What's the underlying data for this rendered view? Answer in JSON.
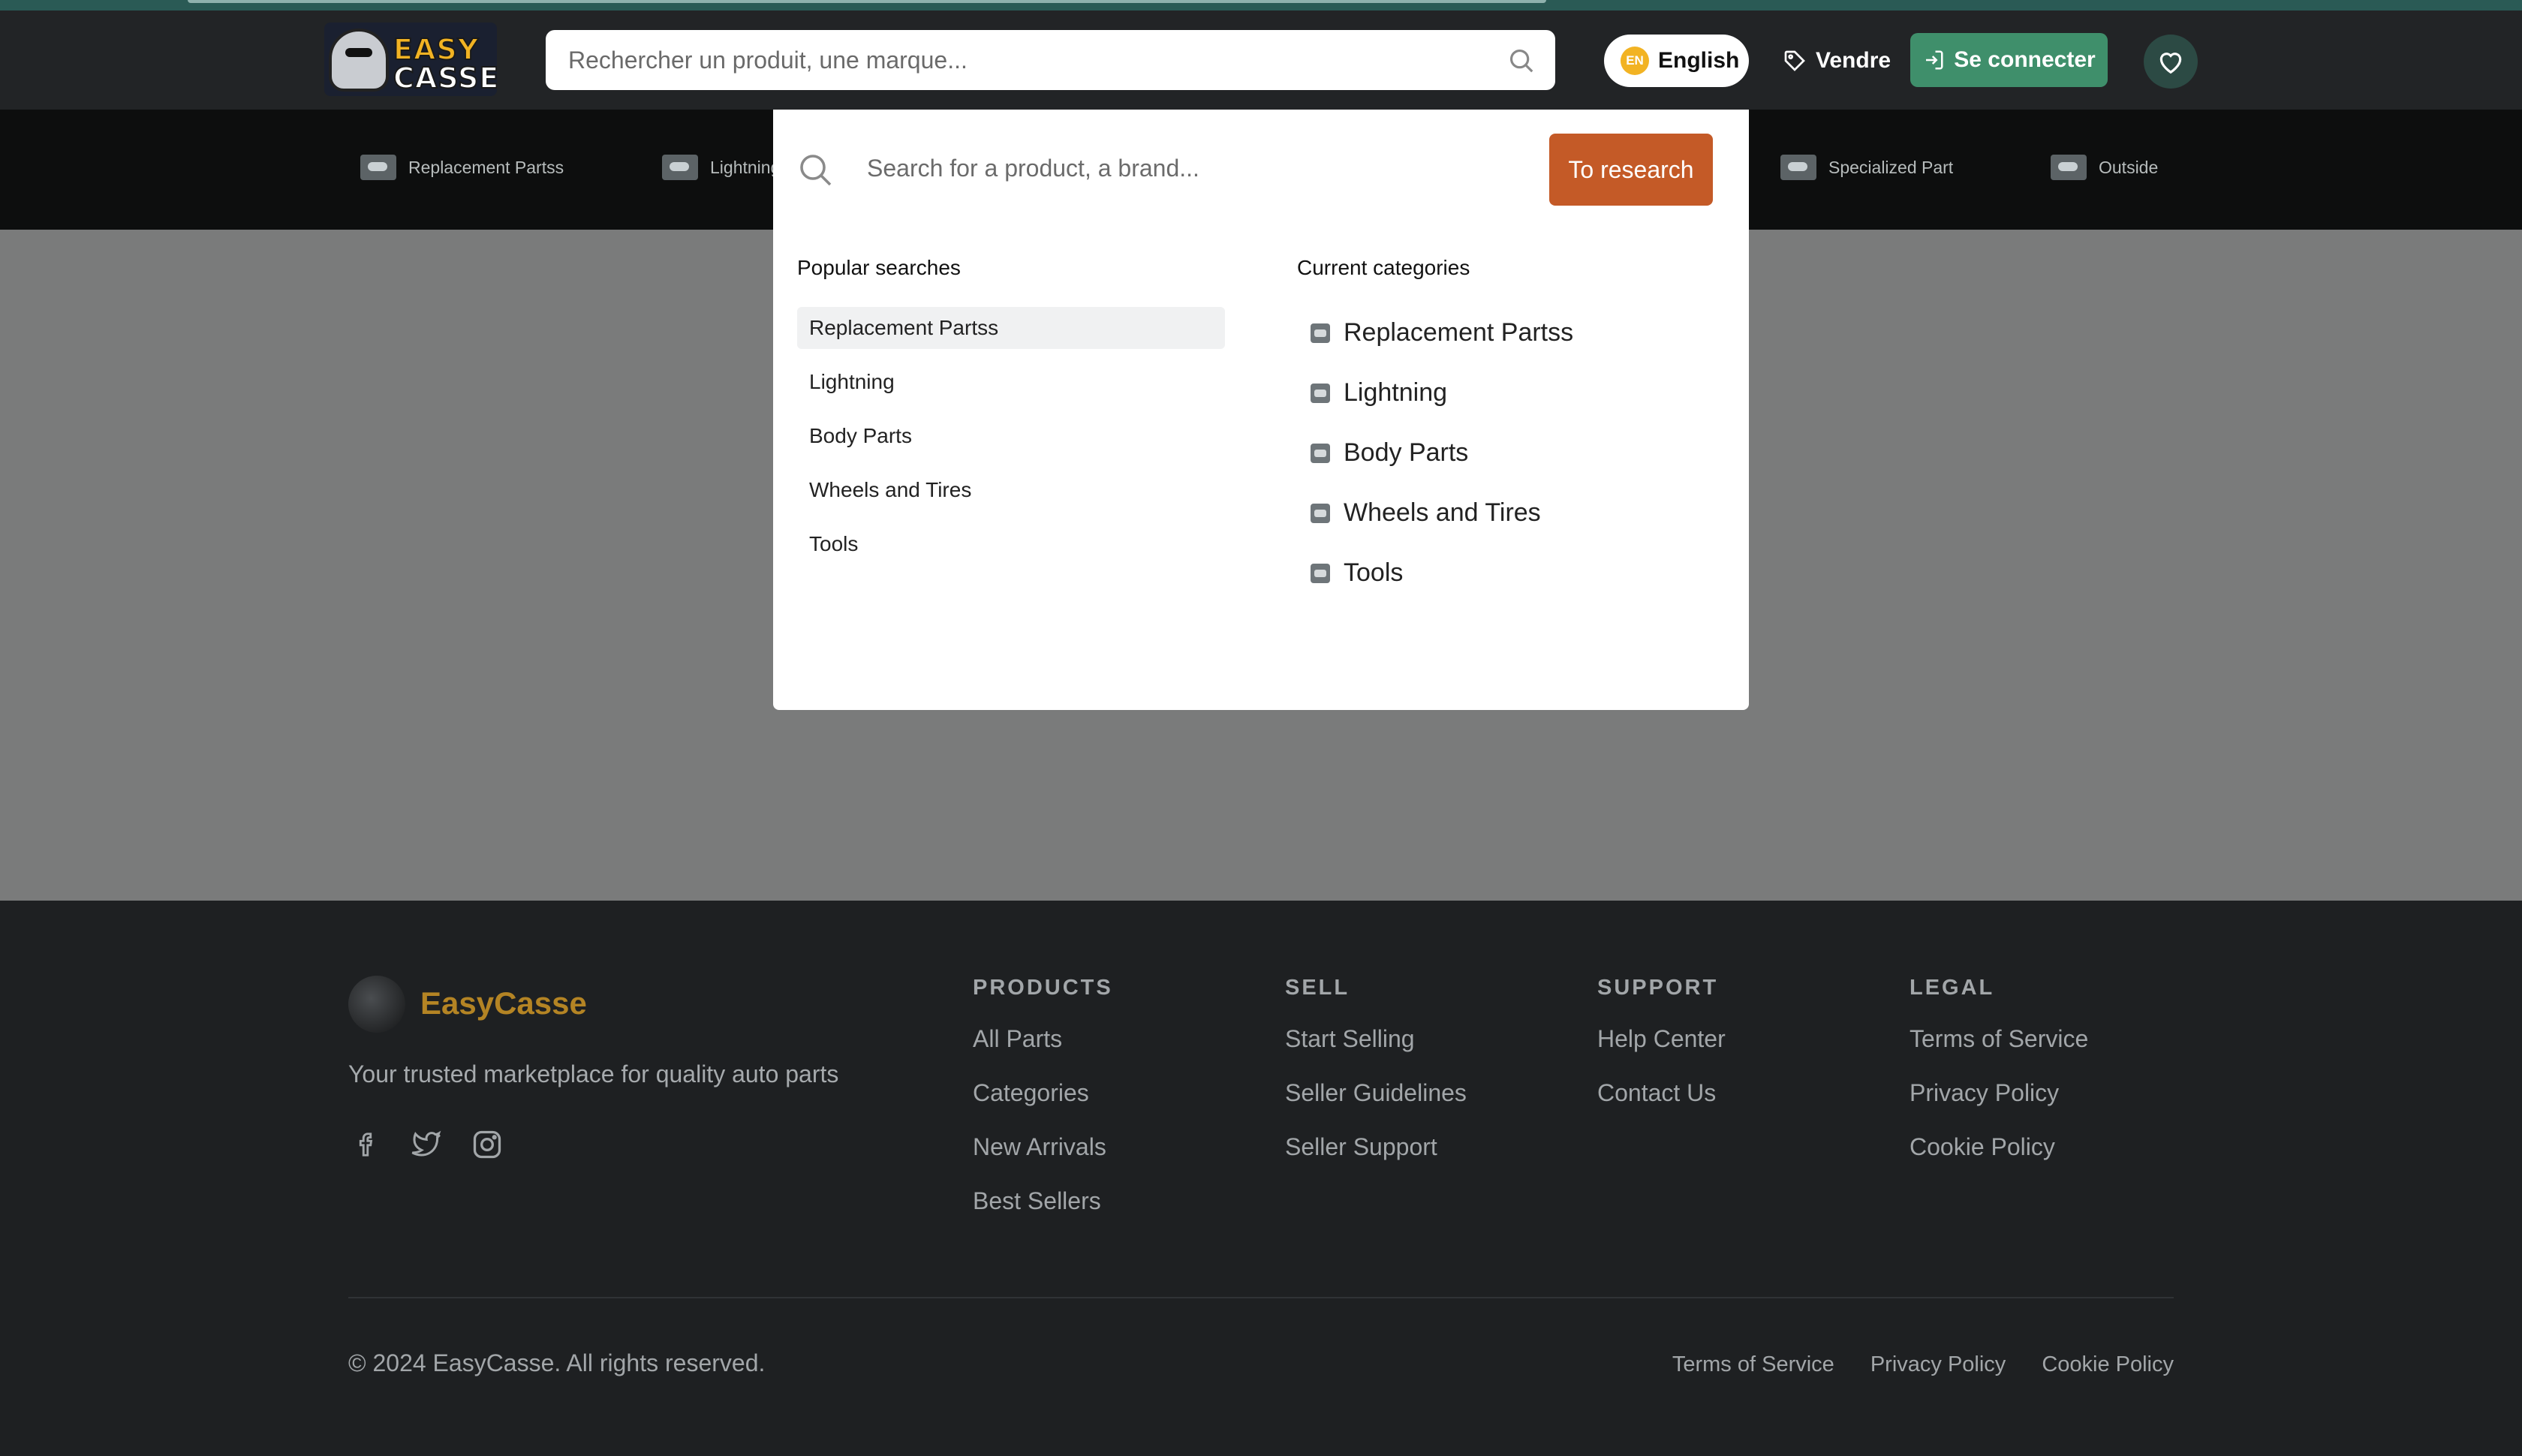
{
  "header": {
    "logo_word1": "EASY",
    "logo_word2": "CASSE",
    "search_placeholder": "Rechercher un produit, une marque...",
    "lang_code": "EN",
    "lang_label": "English",
    "sell_label": "Vendre",
    "login_label": "Se connecter"
  },
  "catnav": {
    "items": [
      {
        "label": "Replacement Partss"
      },
      {
        "label": "Lightning"
      },
      {
        "label": "Specialized Part"
      },
      {
        "label": "Outside"
      }
    ]
  },
  "dropdown": {
    "search_placeholder": "Search for a product, a brand...",
    "button_label": "To research",
    "popular_heading": "Popular searches",
    "popular": [
      "Replacement Partss",
      "Lightning",
      "Body Parts",
      "Wheels and Tires",
      "Tools"
    ],
    "categories_heading": "Current categories",
    "categories": [
      "Replacement Partss",
      "Lightning",
      "Body Parts",
      "Wheels and Tires",
      "Tools"
    ]
  },
  "footer": {
    "brand": "EasyCasse",
    "tagline": "Your trusted marketplace for quality auto parts",
    "columns": [
      {
        "heading": "PRODUCTS",
        "links": [
          "All Parts",
          "Categories",
          "New Arrivals",
          "Best Sellers"
        ]
      },
      {
        "heading": "SELL",
        "links": [
          "Start Selling",
          "Seller Guidelines",
          "Seller Support"
        ]
      },
      {
        "heading": "SUPPORT",
        "links": [
          "Help Center",
          "Contact Us"
        ]
      },
      {
        "heading": "LEGAL",
        "links": [
          "Terms of Service",
          "Privacy Policy",
          "Cookie Policy"
        ]
      }
    ],
    "copyright": "© 2024 EasyCasse. All rights reserved.",
    "bottom_links": [
      "Terms of Service",
      "Privacy Policy",
      "Cookie Policy"
    ]
  },
  "colors": {
    "accent_green": "#3f8f6b",
    "research_button": "#c45a27",
    "brand_gold": "#b48424"
  }
}
